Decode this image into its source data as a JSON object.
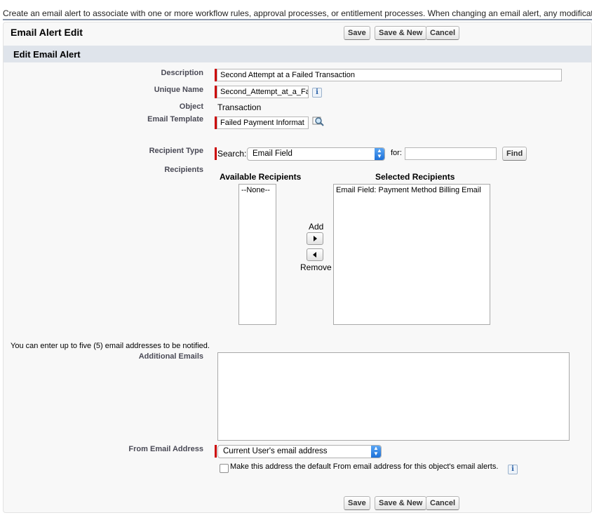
{
  "intro_text": "Create an email alert to associate with one or more workflow rules, approval processes, or entitlement processes. When changing an email alert, any modifications will a",
  "page_title": "Email Alert Edit",
  "buttons": {
    "save": "Save",
    "save_new": "Save & New",
    "cancel": "Cancel"
  },
  "section_title": "Edit Email Alert",
  "fields": {
    "description_label": "Description",
    "description_value": "Second Attempt at a Failed Transaction",
    "unique_name_label": "Unique Name",
    "unique_name_value": "Second_Attempt_at_a_Fa",
    "object_label": "Object",
    "object_value": "Transaction",
    "email_template_label": "Email Template",
    "email_template_value": "Failed Payment Informat",
    "recipient_type_label": "Recipient Type",
    "search_label": "Search:",
    "search_value": "Email Field",
    "for_label": "for:",
    "for_value": "",
    "find_button": "Find",
    "recipients_label": "Recipients"
  },
  "recipients": {
    "available_title": "Available Recipients",
    "available_items": [
      "--None--"
    ],
    "selected_title": "Selected Recipients",
    "selected_items": [
      "Email Field: Payment Method Billing Email"
    ],
    "add_label": "Add",
    "remove_label": "Remove"
  },
  "emails": {
    "note": "You can enter up to five (5) email addresses to be notified.",
    "additional_label": "Additional Emails",
    "additional_value": ""
  },
  "from": {
    "label": "From Email Address",
    "value": "Current User's email address",
    "default_checkbox_label": "Make this address the default From email address for this object's email alerts.",
    "default_checked": false
  },
  "icons": {
    "info": "i",
    "lookup": "lookup-magnifier-icon"
  },
  "colors": {
    "required_bar": "#cc0000",
    "section_bg": "#dfe4eb",
    "select_accent": "#1c70d8"
  }
}
